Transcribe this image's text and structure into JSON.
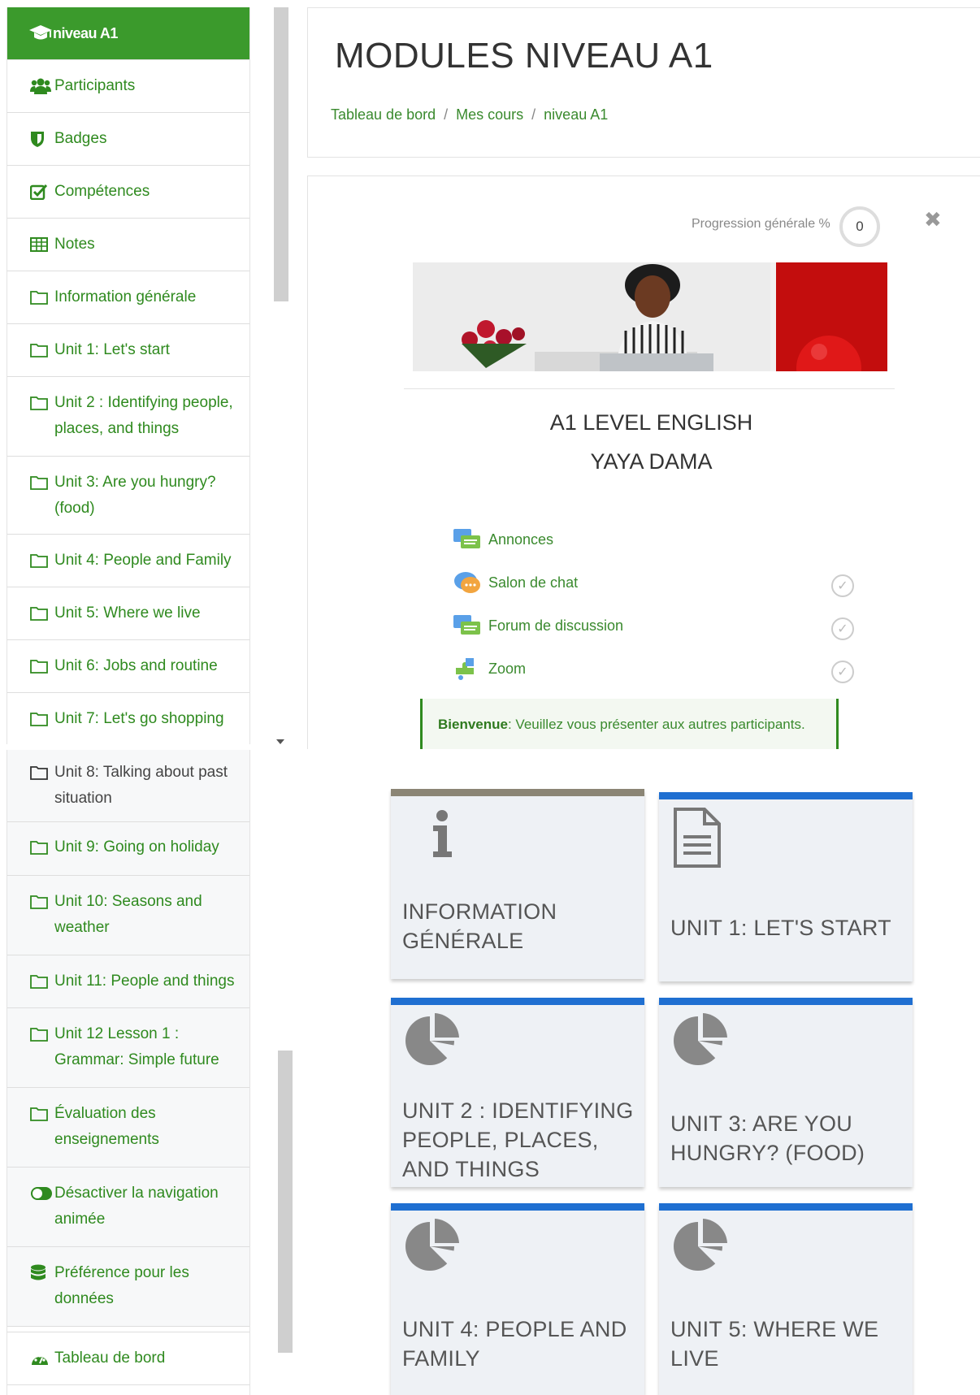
{
  "sidebar_top": [
    {
      "label": "niveau A1",
      "icon": "graduation-cap-icon"
    },
    {
      "label": "Participants",
      "icon": "users-icon"
    },
    {
      "label": "Badges",
      "icon": "shield-icon"
    },
    {
      "label": "Compétences",
      "icon": "check-square-icon"
    },
    {
      "label": "Notes",
      "icon": "table-icon"
    },
    {
      "label": "Information générale",
      "icon": "folder-icon"
    },
    {
      "label": "Unit 1: Let's start",
      "icon": "folder-icon"
    },
    {
      "label": "Unit 2 : Identifying people, places, and things",
      "icon": "folder-icon"
    },
    {
      "label": "Unit 3: Are you hungry? (food)",
      "icon": "folder-icon"
    },
    {
      "label": "Unit 4: People and Family",
      "icon": "folder-icon"
    },
    {
      "label": "Unit 5: Where we live",
      "icon": "folder-icon"
    },
    {
      "label": "Unit 6: Jobs and routine",
      "icon": "folder-icon"
    },
    {
      "label": "Unit 7: Let's go shopping",
      "icon": "folder-icon"
    }
  ],
  "sidebar_bottom": [
    {
      "label": "Unit 8: Talking about past situation",
      "icon": "folder-icon"
    },
    {
      "label": "Unit 9: Going on holiday",
      "icon": "folder-icon"
    },
    {
      "label": "Unit 10: Seasons and weather",
      "icon": "folder-icon"
    },
    {
      "label": "Unit 11: People and things",
      "icon": "folder-icon"
    },
    {
      "label": "Unit 12 Lesson 1 : Grammar: Simple future",
      "icon": "folder-icon"
    },
    {
      "label": "Évaluation des enseignements",
      "icon": "folder-icon"
    },
    {
      "label": "Désactiver la navigation animée",
      "icon": "toggle-icon"
    },
    {
      "label": "Préférence pour les données",
      "icon": "database-icon"
    },
    {
      "label": "Tableau de bord",
      "icon": "dashboard-icon"
    }
  ],
  "header": {
    "title": "MODULES NIVEAU A1",
    "breadcrumb": [
      "Tableau de bord",
      "Mes cours",
      "niveau A1"
    ]
  },
  "summary": {
    "progress_label": "Progression générale %",
    "progress_value": "0",
    "close_icon": "close-icon",
    "course_title_line1": "A1 LEVEL ENGLISH",
    "course_title_line2": "YAYA DAMA",
    "activities": [
      {
        "label": "Annonces",
        "icon": "forum-icon",
        "completion": false
      },
      {
        "label": "Salon de chat",
        "icon": "chat-icon",
        "completion": true
      },
      {
        "label": "Forum de discussion",
        "icon": "forum-icon",
        "completion": true
      },
      {
        "label": "Zoom",
        "icon": "puzzle-icon",
        "completion": true
      }
    ],
    "welcome_bold": "Bienvenue",
    "welcome_text": ": Veuillez vous présenter aux autres participants."
  },
  "tiles": [
    {
      "label": "INFORMATION GÉNÉRALE",
      "icon": "info-icon",
      "accent": "#8b8575"
    },
    {
      "label": "UNIT 1: LET'S START",
      "icon": "document-icon",
      "accent": "#1f6fd1"
    },
    {
      "label": "UNIT 2 : IDENTIFYING PEOPLE, PLACES, AND THINGS",
      "icon": "pie-chart-icon",
      "accent": "#1f6fd1"
    },
    {
      "label": "UNIT 3: ARE YOU HUNGRY? (FOOD)",
      "icon": "pie-chart-icon",
      "accent": "#1f6fd1"
    },
    {
      "label": "UNIT 4: PEOPLE AND FAMILY",
      "icon": "pie-chart-icon",
      "accent": "#1f6fd1"
    },
    {
      "label": "UNIT 5: WHERE WE LIVE",
      "icon": "pie-chart-icon",
      "accent": "#1f6fd1"
    }
  ],
  "colors": {
    "brand_green": "#3b9a2c",
    "link_green": "#2f8a1f",
    "tile_blue": "#1f6fd1"
  }
}
